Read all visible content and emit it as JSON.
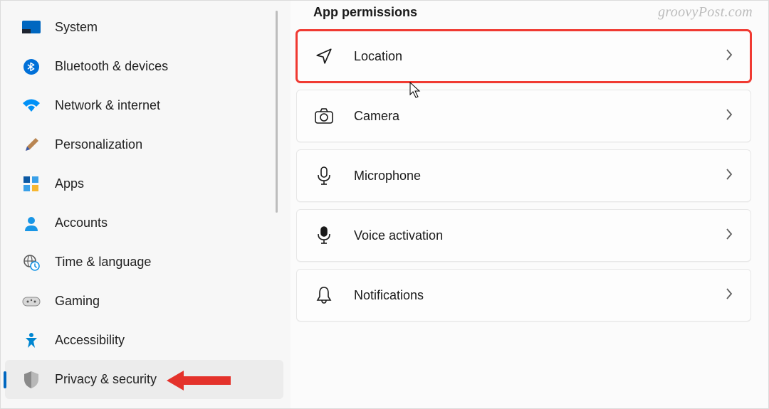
{
  "watermark": "groovyPost.com",
  "sidebar": {
    "items": [
      {
        "label": "System",
        "icon": "system"
      },
      {
        "label": "Bluetooth & devices",
        "icon": "bluetooth"
      },
      {
        "label": "Network & internet",
        "icon": "wifi"
      },
      {
        "label": "Personalization",
        "icon": "brush"
      },
      {
        "label": "Apps",
        "icon": "apps"
      },
      {
        "label": "Accounts",
        "icon": "person"
      },
      {
        "label": "Time & language",
        "icon": "clockglobe"
      },
      {
        "label": "Gaming",
        "icon": "gamepad"
      },
      {
        "label": "Accessibility",
        "icon": "accessibility"
      },
      {
        "label": "Privacy & security",
        "icon": "shield"
      }
    ],
    "activeIndex": 9
  },
  "main": {
    "title": "App permissions",
    "cards": [
      {
        "label": "Location",
        "icon": "location",
        "highlighted": true
      },
      {
        "label": "Camera",
        "icon": "camera"
      },
      {
        "label": "Microphone",
        "icon": "microphone"
      },
      {
        "label": "Voice activation",
        "icon": "voice"
      },
      {
        "label": "Notifications",
        "icon": "bell"
      }
    ]
  },
  "annotations": {
    "highlight_color": "#f03a32",
    "arrow_points_to": "Privacy & security"
  }
}
